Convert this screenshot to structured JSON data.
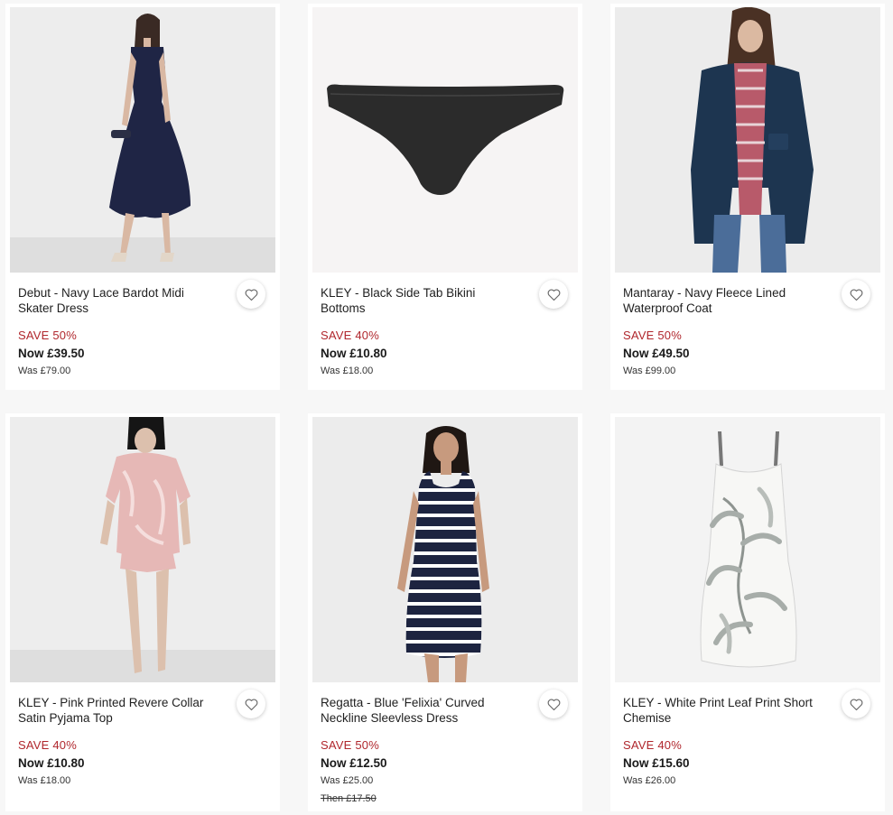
{
  "products": [
    {
      "title": "Debut - Navy Lace Bardot Midi Skater Dress",
      "save": "SAVE 50%",
      "now": "Now £39.50",
      "was": "Was £79.00",
      "image": "navy-lace-dress-photo"
    },
    {
      "title": "KLEY - Black Side Tab Bikini Bottoms",
      "save": "SAVE 40%",
      "now": "Now £10.80",
      "was": "Was £18.00",
      "image": "black-bikini-bottoms-photo"
    },
    {
      "title": "Mantaray - Navy Fleece Lined Waterproof Coat",
      "save": "SAVE 50%",
      "now": "Now £49.50",
      "was": "Was £99.00",
      "image": "navy-coat-photo"
    },
    {
      "title": "KLEY - Pink Printed Revere Collar Satin Pyjama Top",
      "save": "SAVE 40%",
      "now": "Now £10.80",
      "was": "Was £18.00",
      "image": "pink-pyjama-photo"
    },
    {
      "title": "Regatta - Blue 'Felixia' Curved Neckline Sleevless Dress",
      "save": "SAVE 50%",
      "now": "Now £12.50",
      "was": "Was £25.00",
      "then": "Then £17.50",
      "image": "striped-dress-photo"
    },
    {
      "title": "KLEY - White Print Leaf Print Short Chemise",
      "save": "SAVE 40%",
      "now": "Now £15.60",
      "was": "Was £26.00",
      "image": "leaf-chemise-photo"
    }
  ],
  "colors": {
    "save_red": "#b0272d",
    "card_bg": "#ffffff",
    "page_bg": "#f7f7f7"
  }
}
